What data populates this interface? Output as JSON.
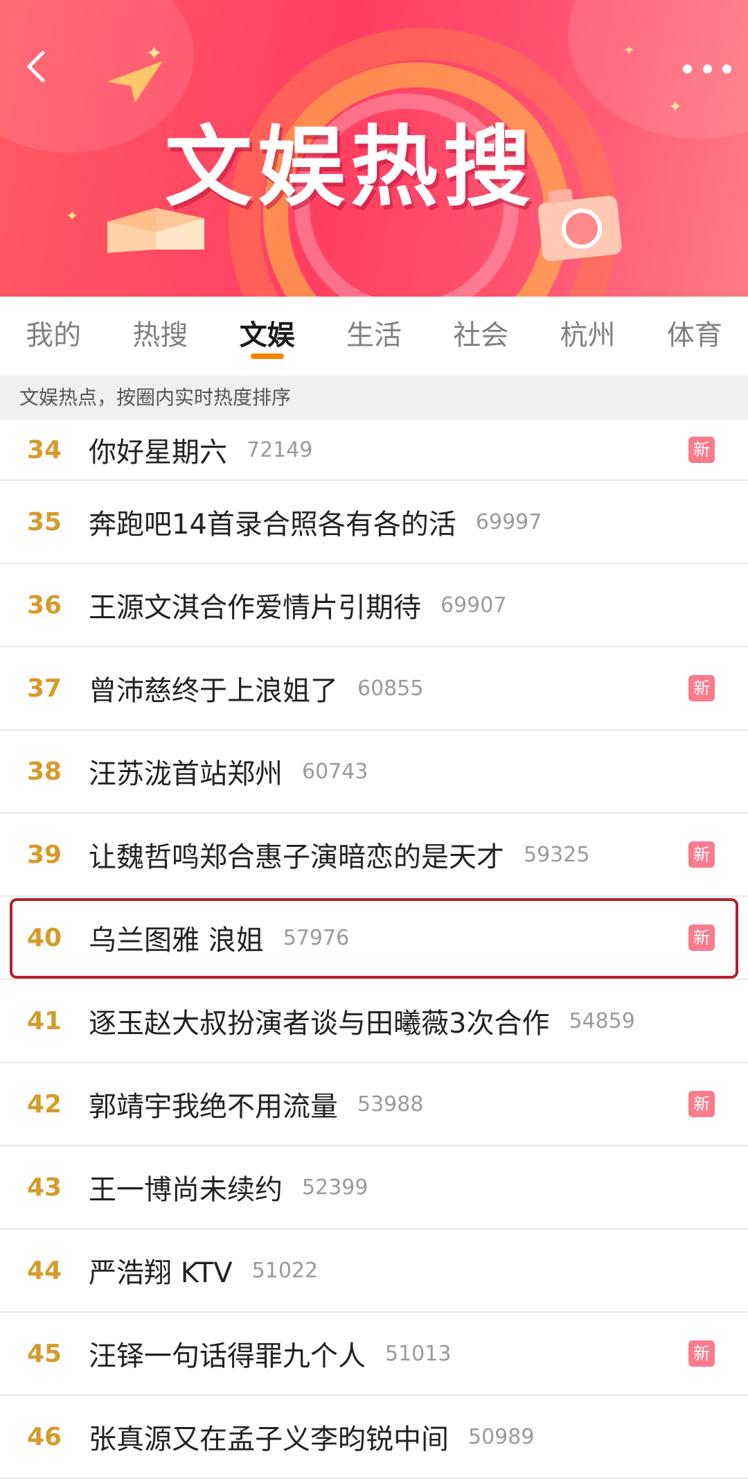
{
  "header": {
    "title": "文娱热搜",
    "back_icon": "chevron-left-icon",
    "more_icon": "more-dots-icon"
  },
  "tabs": [
    {
      "label": "我的",
      "active": false
    },
    {
      "label": "热搜",
      "active": false
    },
    {
      "label": "文娱",
      "active": true
    },
    {
      "label": "生活",
      "active": false
    },
    {
      "label": "社会",
      "active": false
    },
    {
      "label": "杭州",
      "active": false
    },
    {
      "label": "体育",
      "active": false
    }
  ],
  "subtitle": "文娱热点，按圈内实时热度排序",
  "badge_label": "新",
  "colors": {
    "rank": "#d59b2b",
    "active_tab_underline": "#ff8200",
    "badge_bg": "#fa7b8c",
    "highlight_border": "#b3202a"
  },
  "items": [
    {
      "rank": "34",
      "title": "你好星期六",
      "count": "72149",
      "is_new": true
    },
    {
      "rank": "35",
      "title": "奔跑吧14首录合照各有各的活",
      "count": "69997",
      "is_new": false
    },
    {
      "rank": "36",
      "title": "王源文淇合作爱情片引期待",
      "count": "69907",
      "is_new": false
    },
    {
      "rank": "37",
      "title": "曾沛慈终于上浪姐了",
      "count": "60855",
      "is_new": true
    },
    {
      "rank": "38",
      "title": "汪苏泷首站郑州",
      "count": "60743",
      "is_new": false
    },
    {
      "rank": "39",
      "title": "让魏哲鸣郑合惠子演暗恋的是天才",
      "count": "59325",
      "is_new": true
    },
    {
      "rank": "40",
      "title": "乌兰图雅 浪姐",
      "count": "57976",
      "is_new": true,
      "highlighted": true
    },
    {
      "rank": "41",
      "title": "逐玉赵大叔扮演者谈与田曦薇3次合作",
      "count": "54859",
      "is_new": false
    },
    {
      "rank": "42",
      "title": "郭靖宇我绝不用流量",
      "count": "53988",
      "is_new": true
    },
    {
      "rank": "43",
      "title": "王一博尚未续约",
      "count": "52399",
      "is_new": false
    },
    {
      "rank": "44",
      "title": "严浩翔 KTV",
      "count": "51022",
      "is_new": false
    },
    {
      "rank": "45",
      "title": "汪铎一句话得罪九个人",
      "count": "51013",
      "is_new": true
    },
    {
      "rank": "46",
      "title": "张真源又在孟子义李昀锐中间",
      "count": "50989",
      "is_new": false
    }
  ]
}
